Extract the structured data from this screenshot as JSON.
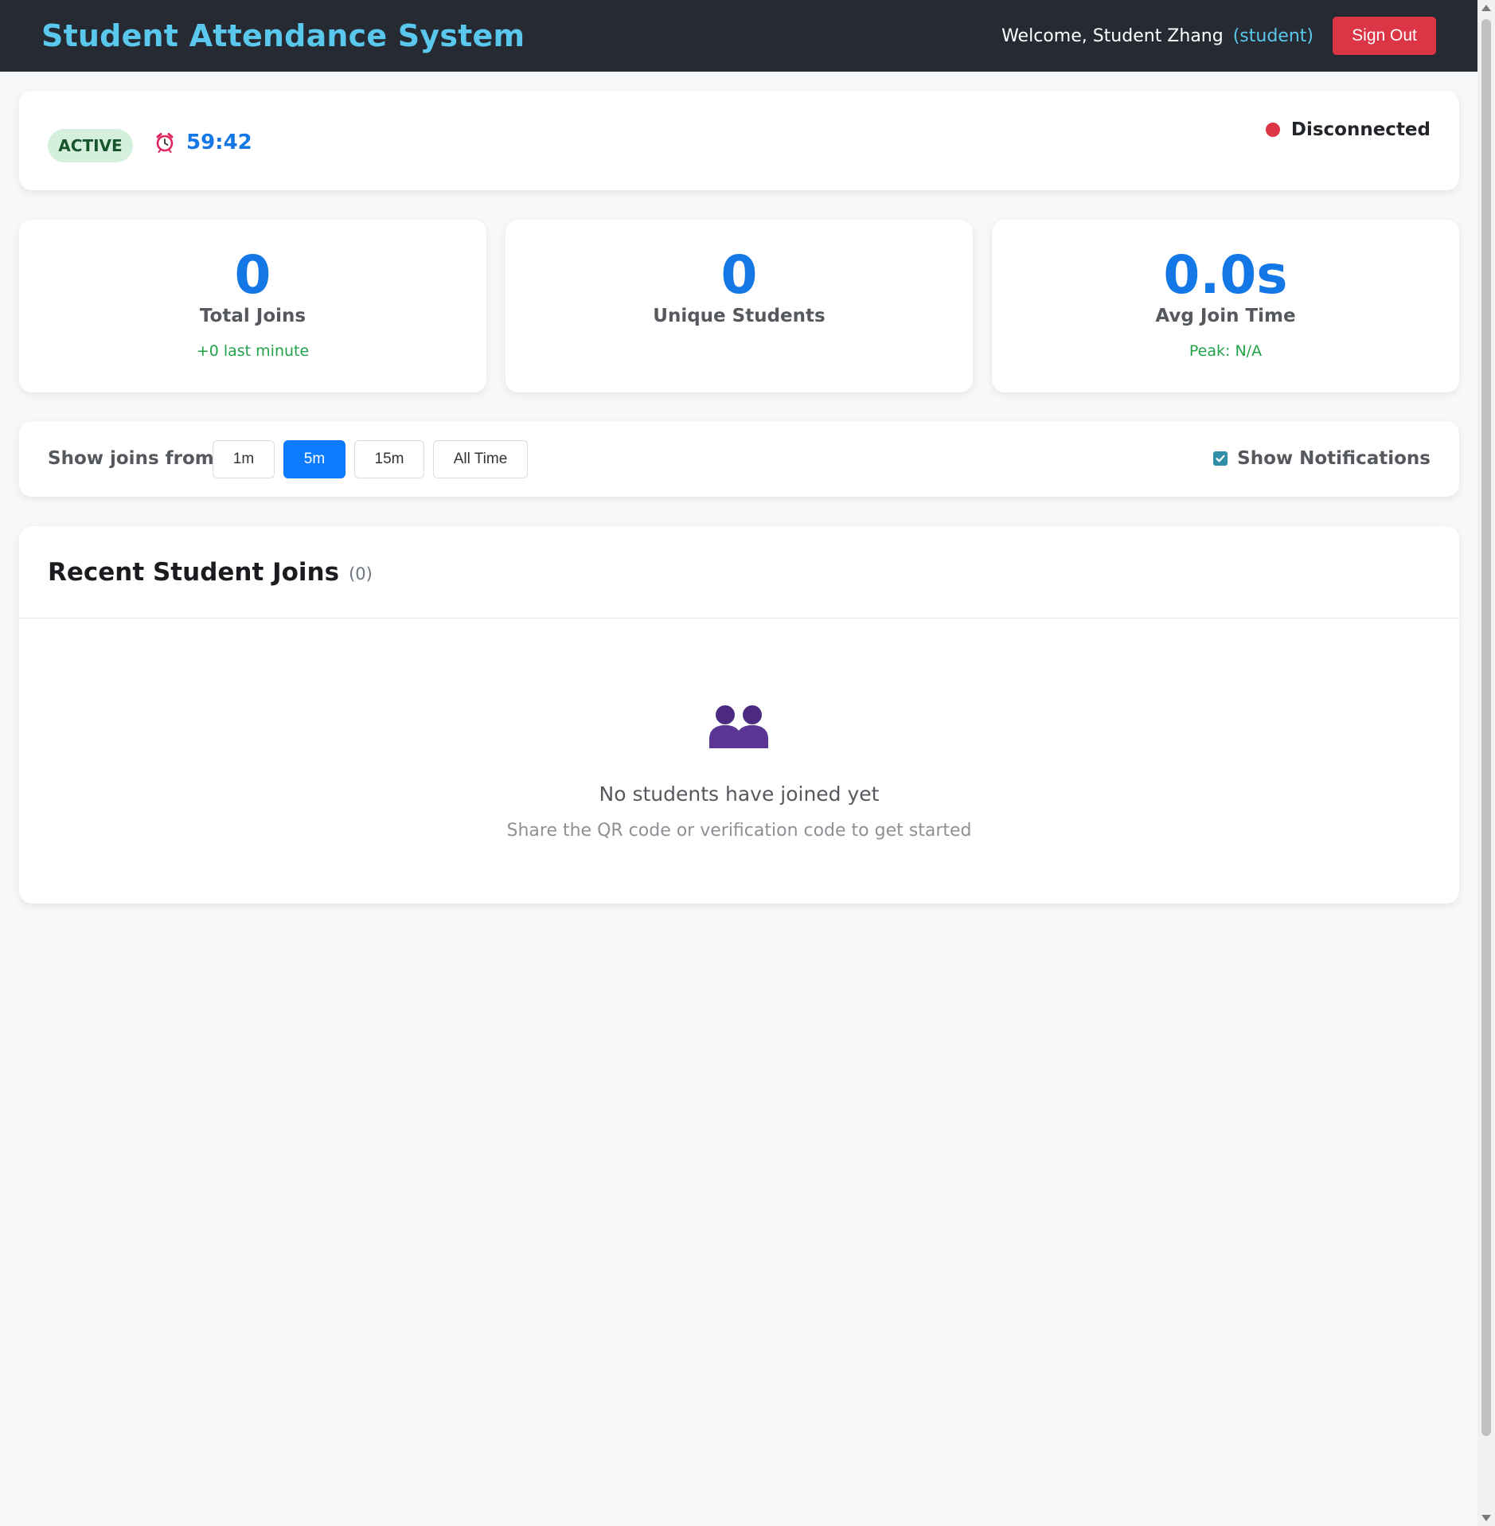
{
  "header": {
    "title": "Student Attendance System",
    "welcome": "Welcome, Student Zhang",
    "role": "(student)",
    "signout_label": "Sign Out"
  },
  "session": {
    "status": "ACTIVE",
    "timer": "59:42",
    "connection": "Disconnected"
  },
  "stats": [
    {
      "value": "0",
      "label": "Total Joins",
      "sub": "+0 last minute"
    },
    {
      "value": "0",
      "label": "Unique Students",
      "sub": ""
    },
    {
      "value": "0.0s",
      "label": "Avg Join Time",
      "sub": "Peak: N/A"
    }
  ],
  "filters": {
    "label": "Show joins from:",
    "options": [
      "1m",
      "5m",
      "15m",
      "All Time"
    ],
    "selected": "5m",
    "notifications_label": "Show Notifications",
    "notifications_checked": true
  },
  "joins": {
    "title": "Recent Student Joins",
    "count": "(0)",
    "empty_title": "No students have joined yet",
    "empty_sub": "Share the QR code or verification code to get started"
  },
  "colors": {
    "accent": "#1477e6",
    "title": "#5ac8ec",
    "danger": "#dc3545",
    "success": "#22a249",
    "selected_filter": "#0d7bff"
  },
  "icons": {
    "timer": "alarm-clock-icon",
    "empty_state": "people-icon",
    "connection": "status-dot-icon"
  }
}
